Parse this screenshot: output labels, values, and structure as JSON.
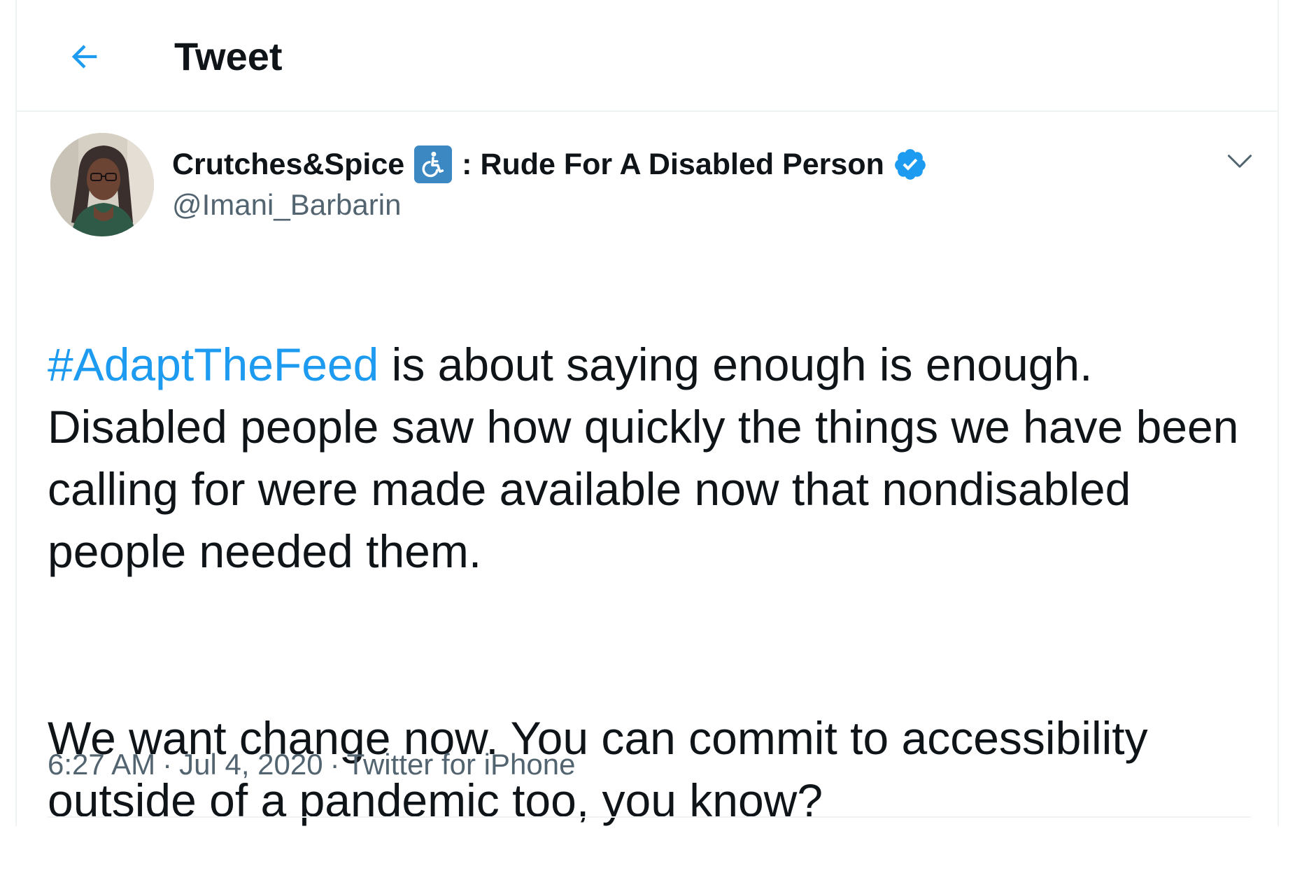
{
  "header": {
    "title": "Tweet",
    "back_icon": "arrow-left-icon"
  },
  "colors": {
    "accent": "#1d9bf0",
    "text_primary": "#0f1419",
    "text_secondary": "#536471",
    "wheelchair_badge": "#3b88c3"
  },
  "author": {
    "display_name": "Crutches&Spice",
    "name_emoji_icon": "wheelchair-symbol-icon",
    "name_suffix": ": Rude For A Disabled Person",
    "verified_icon": "verified-badge-icon",
    "handle": "@Imani_Barbarin"
  },
  "tweet": {
    "hashtag": "#AdaptTheFeed",
    "paragraph_1_rest": " is about saying enough is enough. Disabled people saw how quickly the things we have been calling for were made available now that nondisabled people needed them.",
    "paragraph_2": "We want change now. You can commit to accessibility outside of a pandemic too, you know?"
  },
  "meta": {
    "time": "6:27 AM",
    "separator": "·",
    "date": "Jul 4, 2020",
    "source": "Twitter for iPhone"
  }
}
